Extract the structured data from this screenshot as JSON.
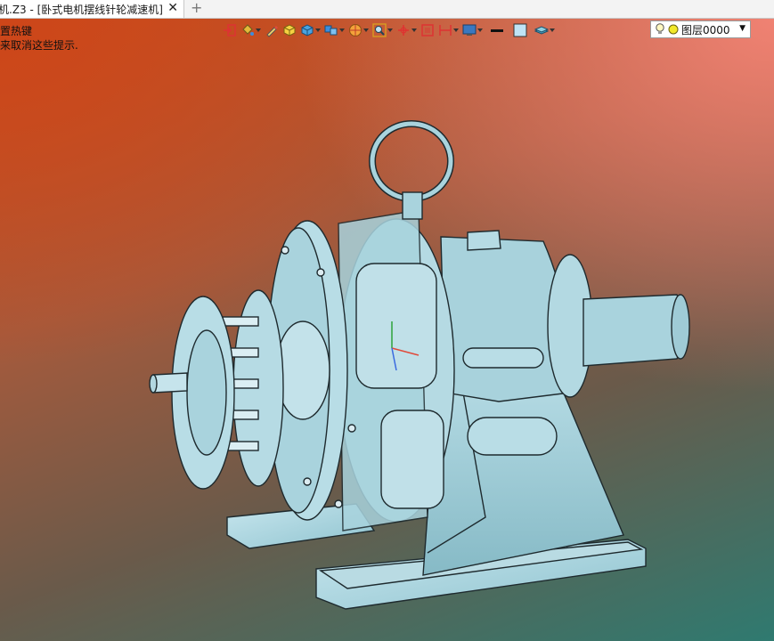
{
  "tab": {
    "title": "机.Z3 - [卧式电机摆线针轮减速机]",
    "close_glyph": "✕",
    "add_glyph": "+"
  },
  "hints": {
    "line1": "置热键",
    "line2": "来取消这些提示."
  },
  "toolbar": {
    "icons": [
      "insert-icon",
      "paint-bucket-icon",
      "pen-icon",
      "box-solid-icon",
      "cube-view-icon",
      "multi-cube-icon",
      "color-wheel-icon",
      "zoom-icon",
      "axis-icon",
      "frame-icon",
      "align-icon",
      "display-icon",
      "line-style-icon",
      "fill-color-icon",
      "layer-stack-icon"
    ],
    "layer": {
      "name": "图层0000"
    }
  },
  "colors": {
    "model_fill": "#a9d3dd",
    "model_edge": "#1e2a2e",
    "bg_top_left": "#c8501f",
    "bg_top_right": "#f08273",
    "bg_bottom_right": "#2f7a70"
  }
}
